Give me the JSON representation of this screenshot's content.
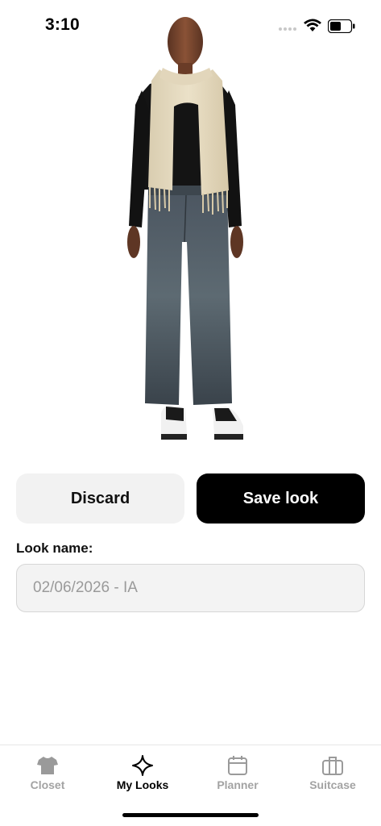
{
  "status_bar": {
    "time": "3:10",
    "icons": [
      "signal-dots-icon",
      "wifi-icon",
      "battery-icon"
    ]
  },
  "hero": {
    "image_description_icon": "mannequin-outfit-image"
  },
  "actions": {
    "discard_label": "Discard",
    "save_label": "Save look"
  },
  "form": {
    "look_name_label": "Look name:",
    "look_name_placeholder": "02/06/2026 - IA",
    "look_name_value": ""
  },
  "tabs": [
    {
      "label": "Closet",
      "icon": "tshirt-icon",
      "active": false
    },
    {
      "label": "My Looks",
      "icon": "sparkle-icon",
      "active": true
    },
    {
      "label": "Planner",
      "icon": "calendar-icon",
      "active": false
    },
    {
      "label": "Suitcase",
      "icon": "suitcase-icon",
      "active": false
    }
  ],
  "colors": {
    "primary_button": "#000000",
    "secondary_button": "#f2f2f2",
    "inactive_tab": "#a3a3a3",
    "active_tab": "#000000"
  }
}
